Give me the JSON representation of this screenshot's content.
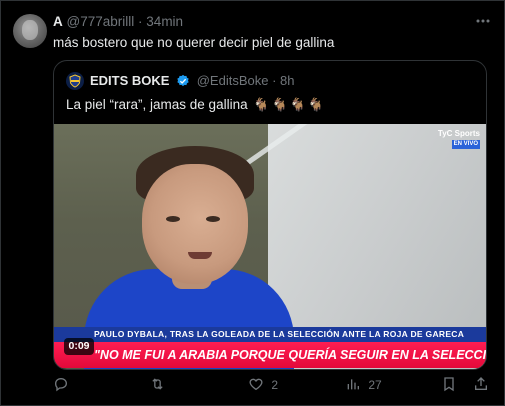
{
  "tweet": {
    "author_initial": "A",
    "handle": "@777abrilll",
    "separator": "·",
    "time": "34min",
    "text": "más bostero que no querer decir piel de gallina",
    "more_icon": "more-dots-icon"
  },
  "quote": {
    "name": "EDITS BOKE",
    "handle": "@EditsBoke",
    "separator": "·",
    "time": "8h",
    "text": "La piel “rara”, jamas de gallina",
    "emojis": [
      "🐐",
      "🐐",
      "🐐",
      "🐐"
    ],
    "video": {
      "duration": "0:09",
      "channel_logo": "TyC Sports",
      "live_badge": "EN VIVO",
      "lower_third_top": "PAULO DYBALA, TRAS LA GOLEADA DE LA SELECCIÓN ANTE LA ROJA DE GARECA",
      "lower_third_main": "\"NO ME FUI A ARABIA PORQUE QUERÍA SEGUIR EN LA SELECCIÓN\""
    }
  },
  "actions": {
    "reply_count": "",
    "retweet_count": "",
    "like_count": "2",
    "views_count": "27"
  },
  "colors": {
    "background": "#000000",
    "text": "#e7e9ea",
    "muted": "#71767b",
    "border": "#2f3336",
    "verified": "#1d9bf0"
  }
}
